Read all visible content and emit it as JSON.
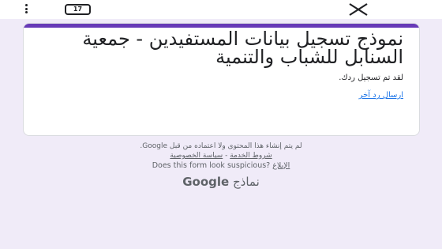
{
  "browser": {
    "menu_icon": "more-vert-icon",
    "tab_count": "17",
    "close_icon": "close-icon"
  },
  "form": {
    "accent_color": "#673ab7",
    "title": "نموذج تسجيل بيانات المستفيدين - جمعية السنابل للشباب والتنمية",
    "confirmation": "لقد تم تسجيل ردك.",
    "resubmit_link": "ارسال رد آخر"
  },
  "footer": {
    "disclaimer": "لم يتم إنشاء هذا المحتوى ولا اعتماده من قبل Google.",
    "terms_link": "شروط الخدمة",
    "separator": " - ",
    "privacy_link": "سياسة الخصوصية",
    "suspicious_text": "Does this form look suspicious?",
    "report_link": "الإبلاغ",
    "brand_google": "Google",
    "brand_forms": "نماذج"
  }
}
